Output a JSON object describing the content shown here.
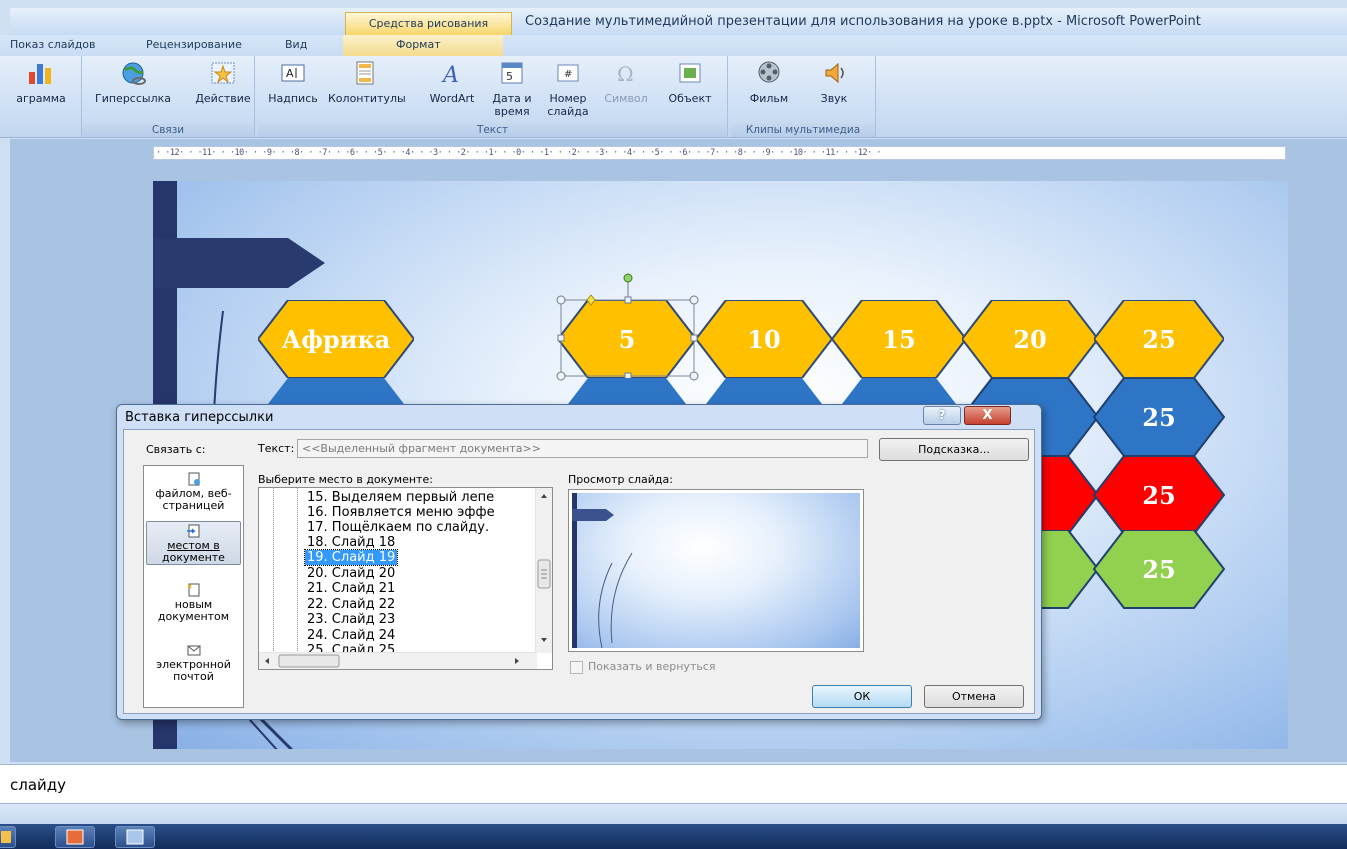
{
  "window": {
    "context_tab": "Средства рисования",
    "title": "Создание мультимедийной презентации для использования на уроке в.pptx - Microsoft PowerPoint"
  },
  "ribbon_tabs": [
    "Показ слайдов",
    "Рецензирование",
    "Вид",
    "Формат"
  ],
  "ribbon": {
    "chart_partial": "аграмма",
    "links_group": {
      "label": "Связи",
      "hyperlink": "Гиперссылка",
      "action": "Действие"
    },
    "text_group": {
      "label": "Текст",
      "textbox": "Надпись",
      "header_footer": "Колонтитулы",
      "wordart": "WordArt",
      "date_time_line1": "Дата и",
      "date_time_line2": "время",
      "slide_number_line1": "Номер",
      "slide_number_line2": "слайда",
      "symbol": "Символ",
      "object": "Объект"
    },
    "media_group": {
      "label": "Клипы мультимедиа",
      "movie": "Фильм",
      "sound": "Звук"
    }
  },
  "ruler": {
    "text": "· ·12· · ·11· · ·10· · ·9· · ·8· · ·7· · ·6· · ·5· · ·4· · ·3· · ·2· · ·1· · ·0· · ·1· · ·2· · ·3· · ·4· · ·5· · ·6· · ·7· · ·8· · ·9· · ·10· · ·11· · ·12· ·"
  },
  "slide": {
    "row1": [
      "Африка",
      "5",
      "10",
      "15",
      "20",
      "25"
    ],
    "row2_last": "25",
    "row3_last": "25",
    "row4_last": "25",
    "colors": {
      "yellow": "#ffc000",
      "blue": "#2e75c6",
      "red": "#ff0000",
      "green": "#92d050"
    }
  },
  "notes": {
    "text": "слайду"
  },
  "dialog": {
    "title": "Вставка гиперссылки",
    "help_glyph": "?",
    "close_glyph": "X",
    "link_with": "Связать с:",
    "link_options": [
      {
        "line1": "файлом, веб-",
        "line2": "страницей"
      },
      {
        "line1": "местом в",
        "line2": "документе"
      },
      {
        "line1": "новым",
        "line2": "документом"
      },
      {
        "line1": "электронной",
        "line2": "почтой"
      }
    ],
    "text_label": "Текст:",
    "text_value": "<<Выделенный фрагмент документа>>",
    "hint_button": "Подсказка...",
    "place_label": "Выберите место в документе:",
    "tree_items": [
      "15. Выделяем первый лепе",
      "16. Появляется меню эффе",
      "17. Пощёлкаем по слайду.",
      "18. Слайд 18",
      "19. Слайд 19",
      "20. Слайд 20",
      "21. Слайд 21",
      "22. Слайд 22",
      "23. Слайд 23",
      "24. Слайд 24",
      "25. Слайд 25"
    ],
    "selected_index": 4,
    "preview_label": "Просмотр слайда:",
    "show_and_return": "Показать и вернуться",
    "ok": "ОК",
    "cancel": "Отмена"
  }
}
